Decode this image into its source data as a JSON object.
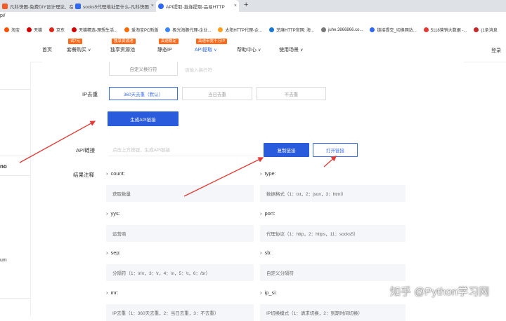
{
  "tabs": [
    {
      "title": "凡科快图-免费DIY设计理论、在线",
      "fav_color": "#f25c28"
    },
    {
      "title": "socks5代理地址是什么-凡科快图",
      "fav_color": "#2f67f6"
    },
    {
      "title": "API提取-直连提取-品易HTTP",
      "fav_color": "#2f67f6",
      "active": true
    }
  ],
  "tab_close": "×",
  "new_tab": "+",
  "url": "pi/",
  "bookmarks": [
    {
      "label": "淘宝",
      "color": "#ff5000"
    },
    {
      "label": "天猫",
      "color": "#d40000"
    },
    {
      "label": "京东",
      "color": "#e1251b"
    },
    {
      "label": "天猫精选-理想生活...",
      "color": "#d40000"
    },
    {
      "label": "爱淘宝PC新版",
      "color": "#ff6a00"
    },
    {
      "label": "极光海豚代理-企业...",
      "color": "#3a86ff"
    },
    {
      "label": "太阳HTTP代理-企...",
      "color": "#ff9f1c"
    },
    {
      "label": "芝麻HTTP官网: 海...",
      "color": "#1976d2"
    },
    {
      "label": "juhe.3866866.co...",
      "color": "#777777"
    },
    {
      "label": "链接提交_切换网站...",
      "color": "#2f67f6"
    },
    {
      "label": "5118营销大数据 -...",
      "color": "#e53935"
    },
    {
      "label": "(1条消息",
      "color": "#c62828"
    }
  ],
  "nav": {
    "items": [
      {
        "label": "首页",
        "dropdown": false
      },
      {
        "label": "套餐购买",
        "dropdown": true,
        "badge": "试7元"
      },
      {
        "label": "独享资源池",
        "dropdown": false,
        "badge": "独享资源池"
      },
      {
        "label": "静态IP",
        "dropdown": false,
        "badge": "高速稳定"
      },
      {
        "label": "API提取",
        "dropdown": true,
        "badge": "高速带宽千万IP",
        "selected": true
      },
      {
        "label": "帮助中心",
        "dropdown": true
      },
      {
        "label": "使用场景",
        "dropdown": true
      }
    ],
    "chevron": "∨",
    "login": "登录"
  },
  "left_panel": {
    "text_a": "no",
    "text_b": "um"
  },
  "form": {
    "separator_row": {
      "custom_label": "自定义换行符",
      "placeholder": "请输入换行符"
    },
    "dedup": {
      "label": "IP去重",
      "options": [
        {
          "label": "360天去重（默认）",
          "selected": true
        },
        {
          "label": "当日去重",
          "selected": false
        },
        {
          "label": "不去重",
          "selected": false
        }
      ]
    },
    "generate_button": "生成API链接",
    "api_link": {
      "label": "API链接",
      "placeholder": "点击上方按钮，生成API链接",
      "copy_button": "复制链接",
      "open_button": "打开链接"
    }
  },
  "results": {
    "label": "结果注释",
    "bullet": "›",
    "params": [
      {
        "name": "count:",
        "desc": "获取数量"
      },
      {
        "name": "type:",
        "desc": "数据格式（1：txt，2：json，3：html）"
      },
      {
        "name": "yys:",
        "desc": "运营商"
      },
      {
        "name": "port:",
        "desc": "代理协议（1：http，2：https，11：socks5）"
      },
      {
        "name": "sep:",
        "desc": "分隔符（1：\\n\\r，3：\\r，4：\\n，5：\\t，6：/br）"
      },
      {
        "name": "sb:",
        "desc": "自定义分隔符"
      },
      {
        "name": "mr:",
        "desc": "IP去重（1：360天去重，2：当日去重，3：不去重）"
      },
      {
        "name": "ip_si:",
        "desc": "IP切换模式（1：请求切换，2：到期时间切换）"
      }
    ]
  },
  "watermark": "知乎 @Python学习网",
  "colors": {
    "accent": "#2a5bdc",
    "badge": "#ff6a1a",
    "arrow": "#e53935"
  }
}
